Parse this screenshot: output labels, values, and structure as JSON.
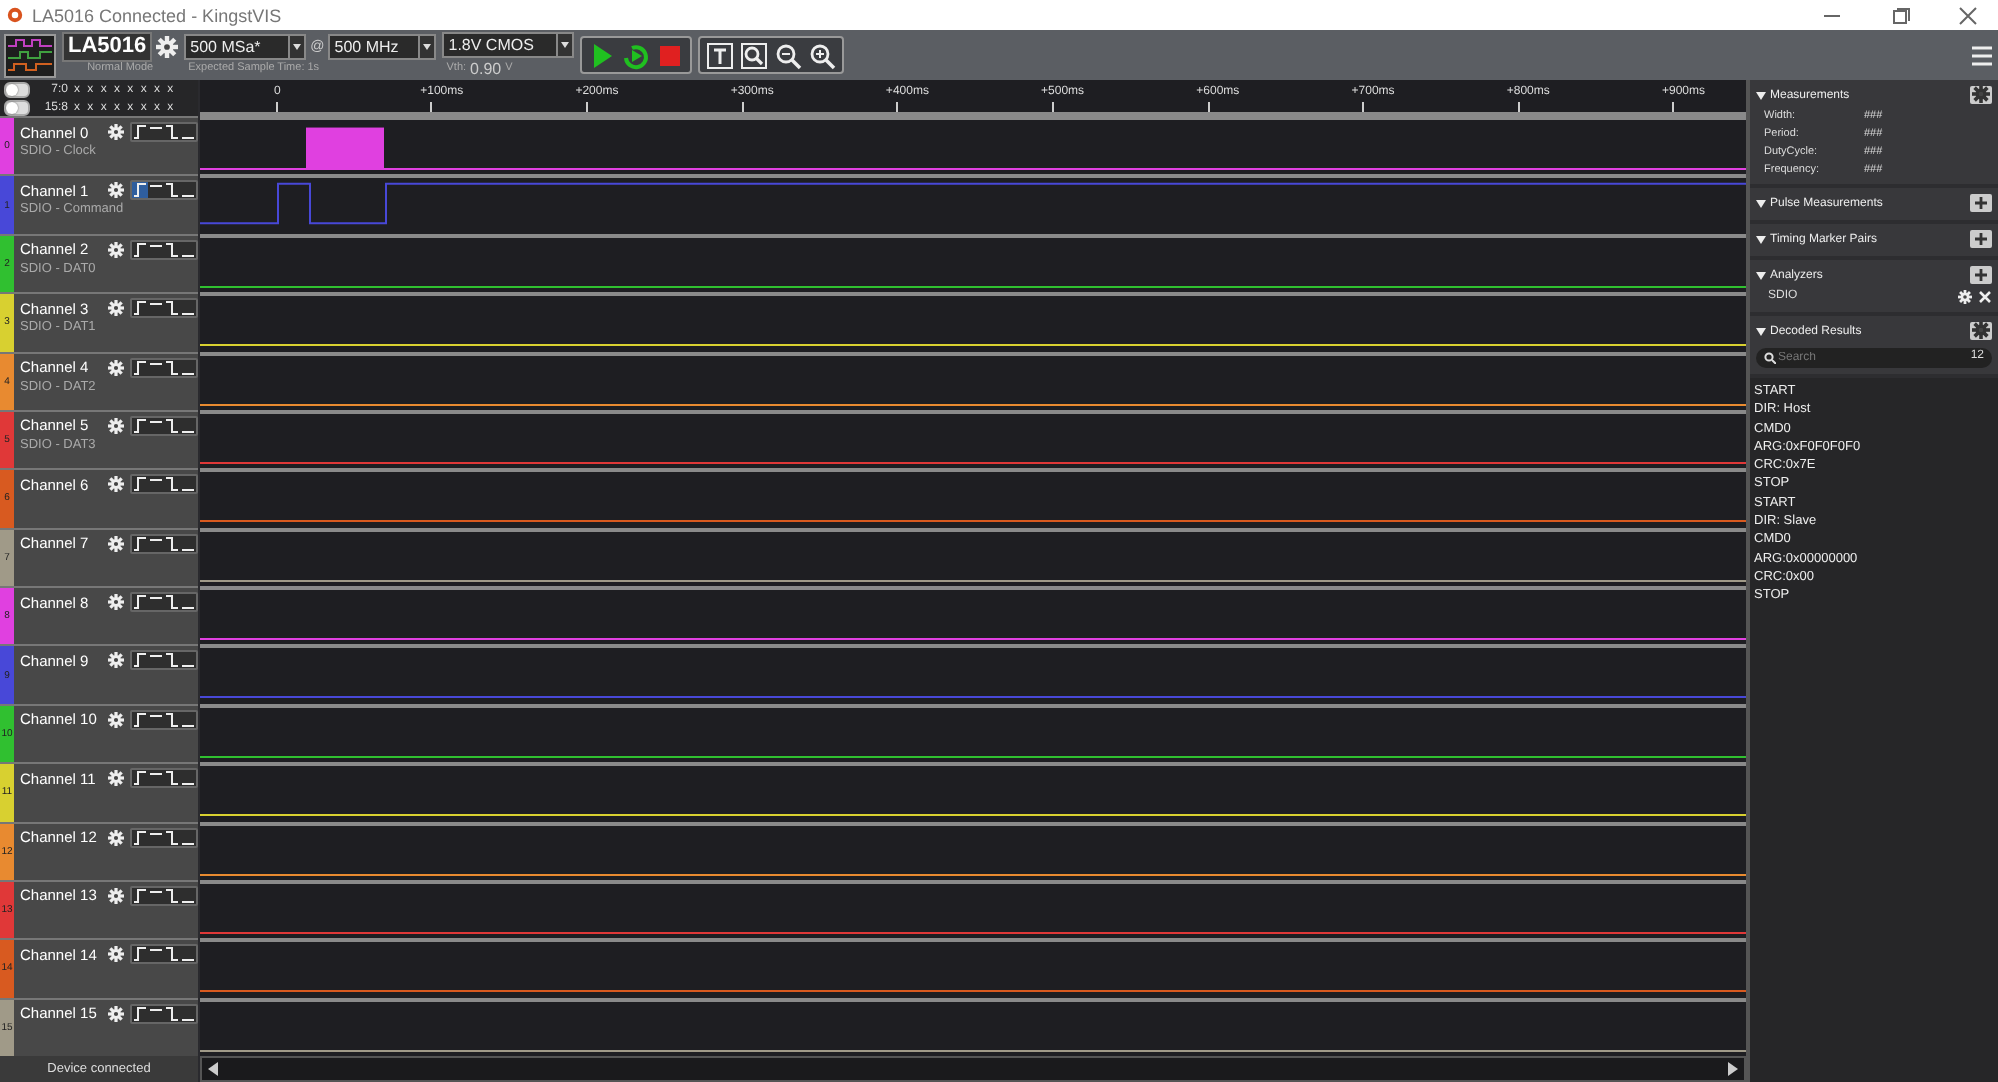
{
  "window": {
    "title": "LA5016 Connected - KingstVIS"
  },
  "toolbar": {
    "device": "LA5016",
    "mode": "Normal Mode",
    "sample_rate": "500 MSa*",
    "at": "@",
    "frequency": "500 MHz",
    "sample_time": "Expected Sample Time: 1s",
    "voltage": "1.8V CMOS",
    "vth_label": "Vth:",
    "vth_value": "0.90",
    "vth_unit": "V"
  },
  "channel_groups": [
    {
      "label": "7:0",
      "on": false,
      "states": "x x x x x x x x"
    },
    {
      "label": "15:8",
      "on": false,
      "states": "x x x x x x x x"
    }
  ],
  "timeline": {
    "ticks": [
      "0",
      "+100ms",
      "+200ms",
      "+300ms",
      "+400ms",
      "+500ms",
      "+600ms",
      "+700ms",
      "+800ms",
      "+900ms"
    ]
  },
  "channels": [
    {
      "number": "0",
      "name": "Channel 0",
      "description": "SDIO - Clock",
      "color": "#e040e0",
      "kind": "burst",
      "triggers": [
        {
          "kind": "rising",
          "selected": false
        },
        {
          "kind": "high",
          "selected": false
        },
        {
          "kind": "falling",
          "selected": false
        },
        {
          "kind": "low",
          "selected": false
        }
      ]
    },
    {
      "number": "1",
      "name": "Channel 1",
      "description": "SDIO - Command",
      "color": "#4848d8",
      "kind": "pulses",
      "triggers": [
        {
          "kind": "rising",
          "selected": true
        },
        {
          "kind": "high",
          "selected": false
        },
        {
          "kind": "falling",
          "selected": false
        },
        {
          "kind": "low",
          "selected": false
        }
      ]
    },
    {
      "number": "2",
      "name": "Channel 2",
      "description": "SDIO - DAT0",
      "color": "#30c030",
      "kind": "low",
      "triggers": [
        {
          "kind": "rising",
          "selected": false
        },
        {
          "kind": "high",
          "selected": false
        },
        {
          "kind": "falling",
          "selected": false
        },
        {
          "kind": "low",
          "selected": false
        }
      ]
    },
    {
      "number": "3",
      "name": "Channel 3",
      "description": "SDIO - DAT1",
      "color": "#d8d030",
      "kind": "low",
      "triggers": [
        {
          "kind": "rising",
          "selected": false
        },
        {
          "kind": "high",
          "selected": false
        },
        {
          "kind": "falling",
          "selected": false
        },
        {
          "kind": "low",
          "selected": false
        }
      ]
    },
    {
      "number": "4",
      "name": "Channel 4",
      "description": "SDIO - DAT2",
      "color": "#e88a30",
      "kind": "low",
      "triggers": [
        {
          "kind": "rising",
          "selected": false
        },
        {
          "kind": "high",
          "selected": false
        },
        {
          "kind": "falling",
          "selected": false
        },
        {
          "kind": "low",
          "selected": false
        }
      ]
    },
    {
      "number": "5",
      "name": "Channel 5",
      "description": "SDIO - DAT3",
      "color": "#e03838",
      "kind": "low",
      "triggers": [
        {
          "kind": "rising",
          "selected": false
        },
        {
          "kind": "high",
          "selected": false
        },
        {
          "kind": "falling",
          "selected": false
        },
        {
          "kind": "low",
          "selected": false
        }
      ]
    },
    {
      "number": "6",
      "name": "Channel 6",
      "color": "#d85a20",
      "kind": "low",
      "triggers": [
        {
          "kind": "rising",
          "selected": false
        },
        {
          "kind": "high",
          "selected": false
        },
        {
          "kind": "falling",
          "selected": false
        },
        {
          "kind": "low",
          "selected": false
        }
      ]
    },
    {
      "number": "7",
      "name": "Channel 7",
      "color": "#a09a88",
      "kind": "low",
      "triggers": [
        {
          "kind": "rising",
          "selected": false
        },
        {
          "kind": "high",
          "selected": false
        },
        {
          "kind": "falling",
          "selected": false
        },
        {
          "kind": "low",
          "selected": false
        }
      ]
    },
    {
      "number": "8",
      "name": "Channel 8",
      "color": "#e040e0",
      "kind": "low",
      "triggers": [
        {
          "kind": "rising",
          "selected": false
        },
        {
          "kind": "high",
          "selected": false
        },
        {
          "kind": "falling",
          "selected": false
        },
        {
          "kind": "low",
          "selected": false
        }
      ]
    },
    {
      "number": "9",
      "name": "Channel 9",
      "color": "#4848d8",
      "kind": "low",
      "triggers": [
        {
          "kind": "rising",
          "selected": false
        },
        {
          "kind": "high",
          "selected": false
        },
        {
          "kind": "falling",
          "selected": false
        },
        {
          "kind": "low",
          "selected": false
        }
      ]
    },
    {
      "number": "10",
      "name": "Channel 10",
      "color": "#30c030",
      "kind": "low",
      "triggers": [
        {
          "kind": "rising",
          "selected": false
        },
        {
          "kind": "high",
          "selected": false
        },
        {
          "kind": "falling",
          "selected": false
        },
        {
          "kind": "low",
          "selected": false
        }
      ]
    },
    {
      "number": "11",
      "name": "Channel 11",
      "color": "#d8d030",
      "kind": "low",
      "triggers": [
        {
          "kind": "rising",
          "selected": false
        },
        {
          "kind": "high",
          "selected": false
        },
        {
          "kind": "falling",
          "selected": false
        },
        {
          "kind": "low",
          "selected": false
        }
      ]
    },
    {
      "number": "12",
      "name": "Channel 12",
      "color": "#e88a30",
      "kind": "low",
      "triggers": [
        {
          "kind": "rising",
          "selected": false
        },
        {
          "kind": "high",
          "selected": false
        },
        {
          "kind": "falling",
          "selected": false
        },
        {
          "kind": "low",
          "selected": false
        }
      ]
    },
    {
      "number": "13",
      "name": "Channel 13",
      "color": "#e03838",
      "kind": "low",
      "triggers": [
        {
          "kind": "rising",
          "selected": false
        },
        {
          "kind": "high",
          "selected": false
        },
        {
          "kind": "falling",
          "selected": false
        },
        {
          "kind": "low",
          "selected": false
        }
      ]
    },
    {
      "number": "14",
      "name": "Channel 14",
      "color": "#d85a20",
      "kind": "low",
      "triggers": [
        {
          "kind": "rising",
          "selected": false
        },
        {
          "kind": "high",
          "selected": false
        },
        {
          "kind": "falling",
          "selected": false
        },
        {
          "kind": "low",
          "selected": false
        }
      ]
    },
    {
      "number": "15",
      "name": "Channel 15",
      "color": "#a09a88",
      "kind": "low",
      "triggers": [
        {
          "kind": "rising",
          "selected": false
        },
        {
          "kind": "high",
          "selected": false
        },
        {
          "kind": "falling",
          "selected": false
        },
        {
          "kind": "low",
          "selected": false
        }
      ]
    }
  ],
  "measurements": {
    "title": "Measurements",
    "rows": [
      {
        "label": "Width:",
        "value": "###"
      },
      {
        "label": "Period:",
        "value": "###"
      },
      {
        "label": "DutyCycle:",
        "value": "###"
      },
      {
        "label": "Frequency:",
        "value": "###"
      }
    ]
  },
  "pulse_measurements": {
    "title": "Pulse Measurements"
  },
  "timing_marker_pairs": {
    "title": "Timing Marker Pairs"
  },
  "analyzers": {
    "title": "Analyzers",
    "items": [
      {
        "name": "SDIO"
      }
    ]
  },
  "decoded_results": {
    "title": "Decoded Results",
    "search": {
      "placeholder": "Search"
    },
    "count": "12",
    "items": [
      "START",
      "DIR: Host",
      "CMD0",
      "ARG:0xF0F0F0F0",
      "CRC:0x7E",
      "STOP",
      "START",
      "DIR: Slave",
      "CMD0",
      "ARG:0x00000000",
      "CRC:0x00",
      "STOP"
    ]
  },
  "status_bar": {
    "text": "Device connected"
  }
}
